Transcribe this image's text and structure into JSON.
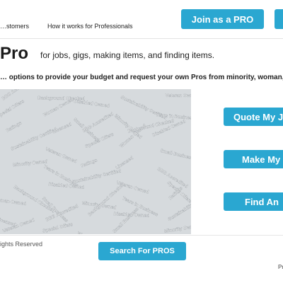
{
  "header": {
    "nav": [
      "…stomers",
      "How it works for Professionals"
    ],
    "join_label": "Join as a PRO",
    "cta_right_label": ""
  },
  "hero": {
    "brand": "Pro",
    "tagline": "for jobs, gigs, making items, and finding items.",
    "subtitle": "… options to provide your budget and request your own Pros from minority, woman,",
    "badge_words": [
      "BBB Accredited",
      "Background Checked",
      "Disabled Owned",
      "Sustainability Certified",
      "Veteran Owned",
      "Special Offers",
      "Woman Owned",
      "Small Business",
      "Minority Owned",
      "Years in Business",
      "Ratings",
      "Licensed"
    ]
  },
  "actions": {
    "quote_label": "Quote My J",
    "make_label": "Make My",
    "find_label": "Find An"
  },
  "footer": {
    "copyright": "ights Reserved",
    "search_label": "Search For PROS",
    "trailing_text": "Pr"
  },
  "colors": {
    "accent": "#2aa7d1",
    "hero_bg": "#d6dadd"
  }
}
